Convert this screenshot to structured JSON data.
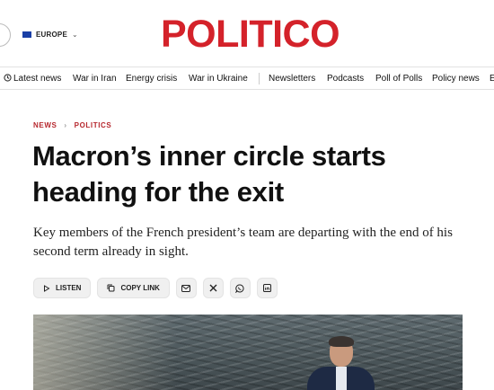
{
  "header": {
    "region_label": "EUROPE",
    "logo": "POLITICO",
    "brand_color": "#d4222a"
  },
  "nav": {
    "items": [
      "Latest news",
      "War in Iran",
      "Energy crisis",
      "War in Ukraine",
      "Newsletters",
      "Podcasts",
      "Poll of Polls",
      "Policy news",
      "E"
    ]
  },
  "breadcrumb": [
    "NEWS",
    "POLITICS"
  ],
  "article": {
    "headline": "Macron’s inner circle starts heading for the exit",
    "dek": "Key members of the French president’s team are departing with the end of his second term already in sight."
  },
  "actions": {
    "listen": "LISTEN",
    "copy_link": "COPY LINK",
    "share_icons": [
      "email-icon",
      "x-icon",
      "whatsapp-icon",
      "linkedin-icon"
    ]
  }
}
